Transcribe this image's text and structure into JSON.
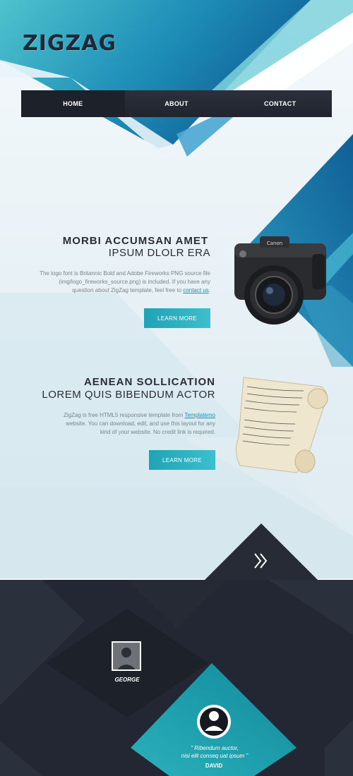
{
  "logo": {
    "text": "ZIGZAG"
  },
  "nav": {
    "items": [
      "HOME",
      "ABOUT",
      "CONTACT"
    ]
  },
  "feature1": {
    "title": "MORBI ACCUMSAN AMET",
    "subtitle": "IPSUM DLOLR ERA",
    "text_a": "The logo font is Britannic Bold and Adobe Fireworks PNG source file",
    "text_b": "(img/logo_fireworks_source.png) is included. If you have any",
    "text_c": "question about ZigZag template, feel free to",
    "link": "contact us",
    "text_d": ".",
    "button": "LEARN MORE",
    "image": "camera-image"
  },
  "feature2": {
    "title": "AENEAN SOLLICATION",
    "subtitle": "LOREM QUIS BIBENDUM ACTOR",
    "text_a": "ZigZag is free HTML5 responsive template from",
    "link": "Templatemo",
    "text_b": "website. You can download, edit, and use this layout for any",
    "text_c": "kind of your website. No credit link is required.",
    "button": "LEARN MORE",
    "image": "scroll-image"
  },
  "next": {
    "icon": "double-chevron-right-icon"
  },
  "team": {
    "member1": {
      "name": "GEORGE",
      "icon": "avatar-icon"
    },
    "member2": {
      "name": "DAVID",
      "quote_line1": "\" Ribendum auctor,",
      "quote_line2": "nisi elit conseq uat ipsum \"",
      "icon": "avatar-icon"
    }
  },
  "colors": {
    "teal": "#1fa3b5",
    "dark": "#222733",
    "blue": "#1477a8"
  }
}
